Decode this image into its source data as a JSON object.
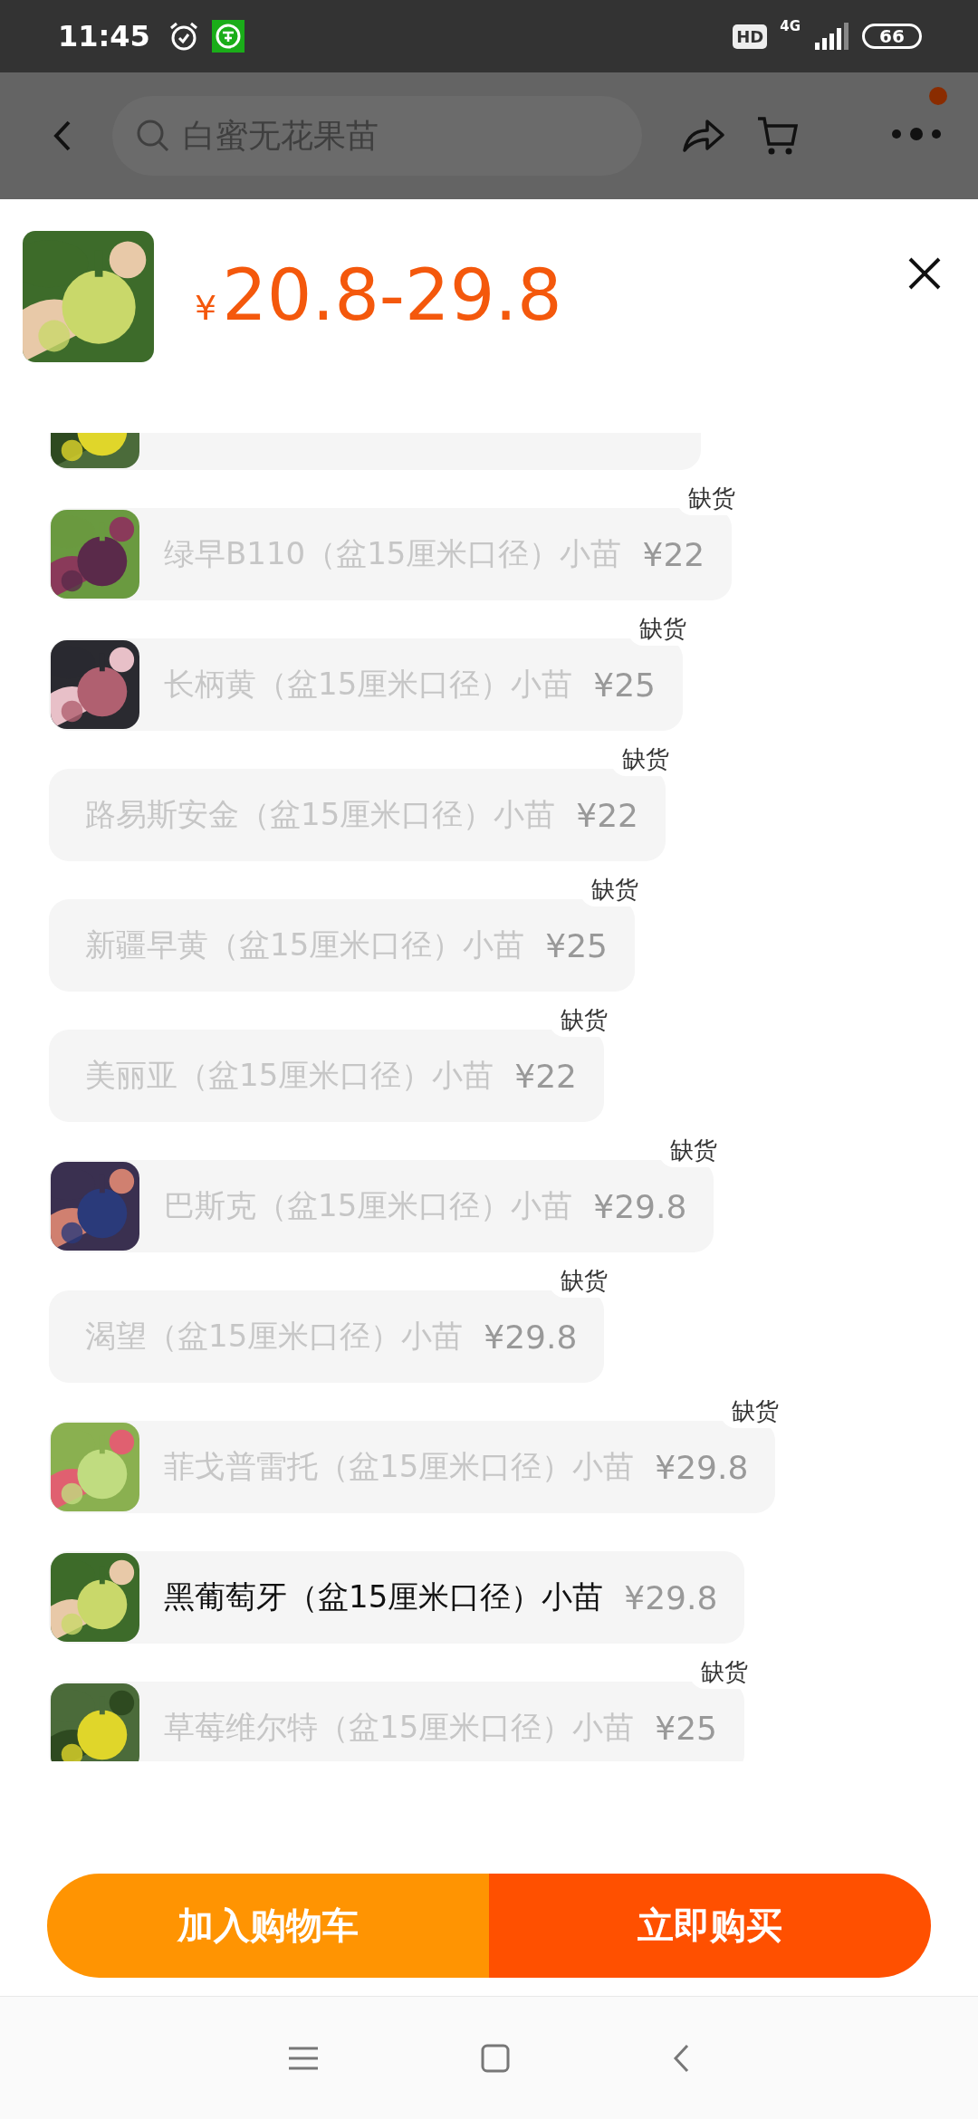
{
  "status_bar": {
    "time": "11:45",
    "hd_label": "HD",
    "network": "4G",
    "battery": "66"
  },
  "top_bar": {
    "search": {
      "placeholder": "白蜜无花果苗"
    },
    "menu_badge": true
  },
  "sheet": {
    "currency": "¥",
    "price": "20.8-29.8"
  },
  "skus": [
    {
      "kind": "partial",
      "has_image": true
    },
    {
      "kind": "option",
      "name": "绿早B110（盆15厘米口径）小苗",
      "price": "¥22",
      "has_image": true,
      "out_of_stock": true,
      "stock_label": "缺货"
    },
    {
      "kind": "option",
      "name": "长柄黄（盆15厘米口径）小苗",
      "price": "¥25",
      "has_image": true,
      "out_of_stock": true,
      "stock_label": "缺货"
    },
    {
      "kind": "option",
      "name": "路易斯安金（盆15厘米口径）小苗",
      "price": "¥22",
      "has_image": false,
      "out_of_stock": true,
      "stock_label": "缺货"
    },
    {
      "kind": "option",
      "name": "新疆早黄（盆15厘米口径）小苗",
      "price": "¥25",
      "has_image": false,
      "out_of_stock": true,
      "stock_label": "缺货"
    },
    {
      "kind": "option",
      "name": "美丽亚（盆15厘米口径）小苗",
      "price": "¥22",
      "has_image": false,
      "out_of_stock": true,
      "stock_label": "缺货"
    },
    {
      "kind": "option",
      "name": "巴斯克（盆15厘米口径）小苗",
      "price": "¥29.8",
      "has_image": true,
      "out_of_stock": true,
      "stock_label": "缺货"
    },
    {
      "kind": "option",
      "name": "渴望（盆15厘米口径）小苗",
      "price": "¥29.8",
      "has_image": false,
      "out_of_stock": true,
      "stock_label": "缺货"
    },
    {
      "kind": "option",
      "name": "菲戈普雷托（盆15厘米口径）小苗",
      "price": "¥29.8",
      "has_image": true,
      "out_of_stock": true,
      "stock_label": "缺货"
    },
    {
      "kind": "option",
      "name": "黑葡萄牙（盆15厘米口径）小苗",
      "price": "¥29.8",
      "has_image": true,
      "out_of_stock": false
    },
    {
      "kind": "option",
      "name": "草莓维尔特（盆15厘米口径）小苗",
      "price": "¥25",
      "has_image": true,
      "out_of_stock": true,
      "stock_label": "缺货"
    }
  ],
  "actions": [
    {
      "kind": "cart",
      "label": "加入购物车"
    },
    {
      "kind": "buy",
      "label": "立即购买"
    }
  ]
}
